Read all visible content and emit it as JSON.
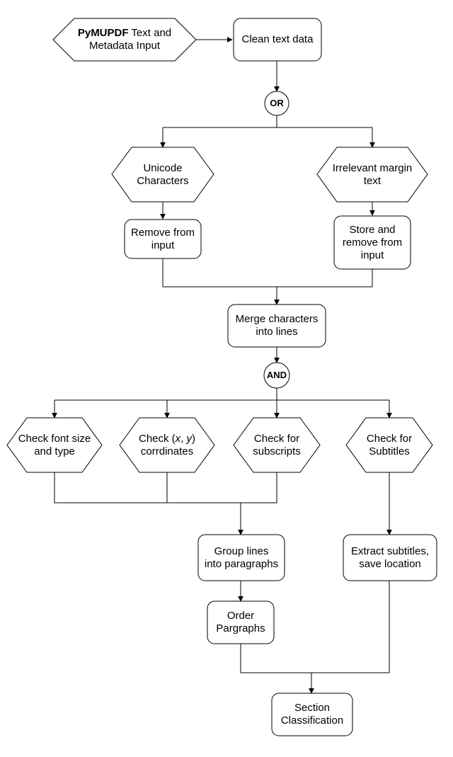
{
  "nodes": {
    "input": {
      "line1_bold": "PyMUPDF",
      "line1_rest": " Text and",
      "line2": "Metadata Input"
    },
    "clean": "Clean text data",
    "gate_or": "OR",
    "unicode": {
      "line1": "Unicode",
      "line2": "Characters"
    },
    "margin": {
      "line1": "Irrelevant margin",
      "line2": "text"
    },
    "remove": {
      "line1": "Remove from",
      "line2": "input"
    },
    "store_remove": {
      "line1": "Store and",
      "line2": "remove from",
      "line3": "input"
    },
    "merge": {
      "line1": "Merge characters",
      "line2": "into lines"
    },
    "gate_and": "AND",
    "check_font": {
      "line1": "Check font size",
      "line2": "and type"
    },
    "check_xy": {
      "line1_a": "Check (",
      "line1_x": "x",
      "line1_comma": ", ",
      "line1_y": "y",
      "line1_b": ")",
      "line2": "corrdinates"
    },
    "check_sub": {
      "line1": "Check for",
      "line2": "subscripts"
    },
    "check_subtitles": {
      "line1": "Check for",
      "line2": "Subtitles"
    },
    "group_lines": {
      "line1": "Group lines",
      "line2": "into paragraphs"
    },
    "order": {
      "line1": "Order",
      "line2": "Pargraphs"
    },
    "extract_subtitles": {
      "line1": "Extract subtitles,",
      "line2": "save location"
    },
    "section": {
      "line1": "Section",
      "line2": "Classification"
    }
  }
}
